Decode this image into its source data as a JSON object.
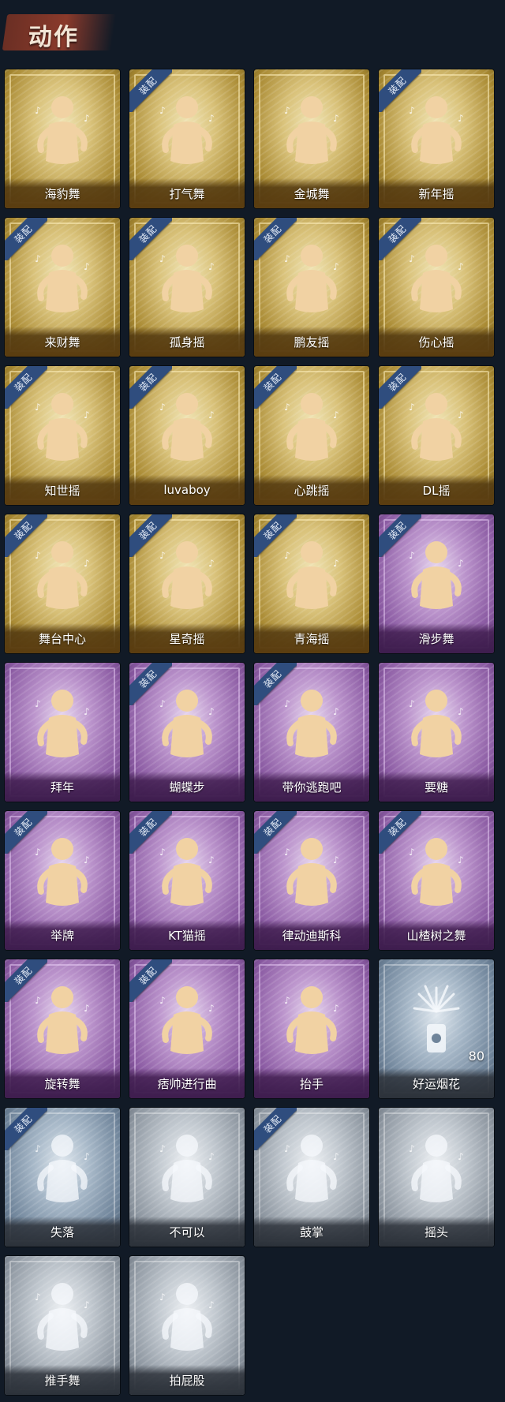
{
  "header": {
    "title": "动作"
  },
  "equip_label": "装配",
  "items": [
    {
      "name": "海豹舞",
      "tier": "gold",
      "equipped": false
    },
    {
      "name": "打气舞",
      "tier": "gold",
      "equipped": true
    },
    {
      "name": "金城舞",
      "tier": "gold",
      "equipped": false
    },
    {
      "name": "新年摇",
      "tier": "gold",
      "equipped": true
    },
    {
      "name": "来财舞",
      "tier": "gold",
      "equipped": true
    },
    {
      "name": "孤身摇",
      "tier": "gold",
      "equipped": true
    },
    {
      "name": "鹏友摇",
      "tier": "gold",
      "equipped": true
    },
    {
      "name": "伤心摇",
      "tier": "gold",
      "equipped": true
    },
    {
      "name": "知世摇",
      "tier": "gold",
      "equipped": true
    },
    {
      "name": "luvaboy",
      "tier": "gold",
      "equipped": true
    },
    {
      "name": "心跳摇",
      "tier": "gold",
      "equipped": true
    },
    {
      "name": "DL摇",
      "tier": "gold",
      "equipped": true
    },
    {
      "name": "舞台中心",
      "tier": "gold",
      "equipped": true
    },
    {
      "name": "星奇摇",
      "tier": "gold",
      "equipped": true
    },
    {
      "name": "青海摇",
      "tier": "gold",
      "equipped": true
    },
    {
      "name": "滑步舞",
      "tier": "purple",
      "equipped": true
    },
    {
      "name": "拜年",
      "tier": "purple",
      "equipped": false
    },
    {
      "name": "蝴蝶步",
      "tier": "purple",
      "equipped": true
    },
    {
      "name": "带你逃跑吧",
      "tier": "purple",
      "equipped": true
    },
    {
      "name": "要糖",
      "tier": "purple",
      "equipped": false
    },
    {
      "name": "举牌",
      "tier": "purple",
      "equipped": true
    },
    {
      "name": "KT猫摇",
      "tier": "purple",
      "equipped": true
    },
    {
      "name": "律动迪斯科",
      "tier": "purple",
      "equipped": true
    },
    {
      "name": "山楂树之舞",
      "tier": "purple",
      "equipped": true
    },
    {
      "name": "旋转舞",
      "tier": "purple",
      "equipped": true
    },
    {
      "name": "痞帅进行曲",
      "tier": "purple",
      "equipped": true
    },
    {
      "name": "抬手",
      "tier": "purple",
      "equipped": false
    },
    {
      "name": "好运烟花",
      "tier": "blue",
      "equipped": false,
      "count": "80"
    },
    {
      "name": "失落",
      "tier": "blue",
      "equipped": true
    },
    {
      "name": "不可以",
      "tier": "silver",
      "equipped": false
    },
    {
      "name": "鼓掌",
      "tier": "silver",
      "equipped": true
    },
    {
      "name": "摇头",
      "tier": "silver",
      "equipped": false
    },
    {
      "name": "推手舞",
      "tier": "silver",
      "equipped": false
    },
    {
      "name": "拍屁股",
      "tier": "silver",
      "equipped": false
    }
  ]
}
